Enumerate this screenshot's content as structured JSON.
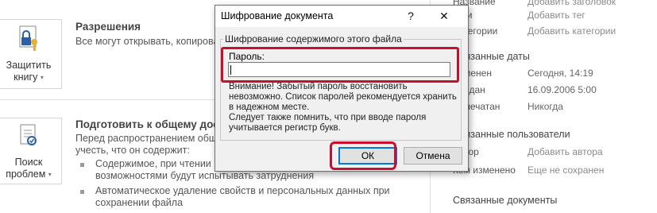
{
  "left": {
    "protect_tile": {
      "line1": "Защитить",
      "line2": "книгу",
      "icon": "lock-key-document-icon"
    },
    "inspect_tile": {
      "line1": "Поиск",
      "line2": "проблем",
      "icon": "document-checklist-icon"
    },
    "permissions": {
      "title": "Разрешения",
      "text": "Все могут открывать, копировать"
    },
    "prepare": {
      "title": "Подготовить к общему дос",
      "text1": "Перед распространением общ",
      "text2": "учесть, что он содержит:",
      "bullets": [
        {
          "line1": "Содержимое, при чтении к",
          "line2": "возможностями будут испытывать затруднения"
        },
        {
          "line1": "Автоматическое удаление свойств и персональных данных при",
          "line2": "сохранении файла"
        }
      ]
    }
  },
  "right": {
    "rows_top": [
      {
        "label": "Название",
        "value": "Добавить заголовок"
      },
      {
        "label": "Теги",
        "value": "Добавить тег"
      },
      {
        "label": "Категории",
        "value": "Добавить категории"
      }
    ],
    "related_dates_header": "Связанные даты",
    "dates": [
      {
        "label": "Изменен",
        "value": "Сегодня, 14:19"
      },
      {
        "label": "Создан",
        "value": "16.09.2006 5:00"
      },
      {
        "label": "Напечатан",
        "value": "Никогда"
      }
    ],
    "related_people_header": "Связанные пользователи",
    "people": [
      {
        "label": "Автор",
        "value": "Добавить автора"
      },
      {
        "label": "Кем изменено",
        "value": "Еще не сохранен"
      }
    ],
    "related_docs_header": "Связанные документы"
  },
  "dialog": {
    "title": "Шифрование документа",
    "help": "?",
    "close": "✕",
    "group_label": "Шифрование содержимого этого файла",
    "password_label": "Пароль:",
    "password_value": "",
    "warning_lines": [
      "Внимание! Забытый пароль восстановить",
      "невозможно. Список паролей рекомендуется хранить",
      "в надежном месте.",
      "Следует также помнить, что при вводе пароля",
      "учитывается регистр букв."
    ],
    "ok_label": "ОК",
    "cancel_label": "Отмена"
  },
  "colors": {
    "annotation_red": "#c8102e",
    "focus_blue": "#0078d7"
  }
}
